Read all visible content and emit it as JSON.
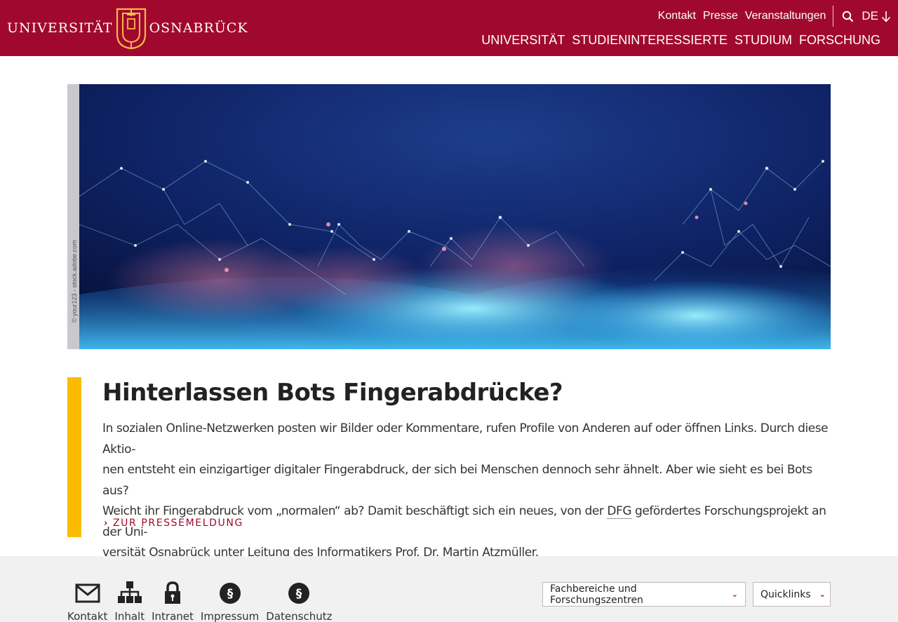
{
  "header": {
    "logo": {
      "left_text": "UNIVERSITÄT",
      "right_text": "OSNABRÜCK"
    },
    "meta_nav": [
      "Kontakt",
      "Presse",
      "Veranstaltungen"
    ],
    "language": "DE",
    "main_nav": [
      "UNIVERSITÄT",
      "STUDIENINTERESSIERTE",
      "STUDIUM",
      "FORSCHUNG"
    ]
  },
  "hero": {
    "credit": "© your123 - stock.adobe.com"
  },
  "teaser": {
    "title": "Hinterlassen Bots Fingerabdrücke?",
    "lines": [
      "In sozialen Online-Netzwerken posten wir Bilder oder Kommentare, rufen Profile von Anderen auf oder öffnen Links. Durch diese Aktio-",
      "nen entsteht ein einzigartiger digitaler Fingerabdruck, der sich bei Menschen dennoch sehr ähnelt. Aber wie sieht es bei Bots aus?",
      "Weicht ihr Fingerabdruck vom „normalen“ ab? Damit beschäftigt sich ein neues, von der ",
      "DFG",
      " gefördertes Forschungsprojekt an der Uni-",
      "versität Osnabrück unter Leitung des Informatikers Prof. Dr. Martin Atzmüller."
    ],
    "link_label": "ZUR PRESSEMELDUNG"
  },
  "footer": {
    "links": [
      {
        "label": "Kontakt",
        "icon": "envelope-icon"
      },
      {
        "label": "Inhalt",
        "icon": "sitemap-icon"
      },
      {
        "label": "Intranet",
        "icon": "lock-icon"
      },
      {
        "label": "Impressum",
        "icon": "paragraph-icon"
      },
      {
        "label": "Datenschutz",
        "icon": "paragraph-icon"
      }
    ],
    "select_faculties": "Fachbereiche und Forschungszentren",
    "select_quicklinks": "Quicklinks"
  },
  "colors": {
    "brand": "#a0092d",
    "accent": "#fbbc00",
    "footer_bg": "#f1f1f1"
  }
}
